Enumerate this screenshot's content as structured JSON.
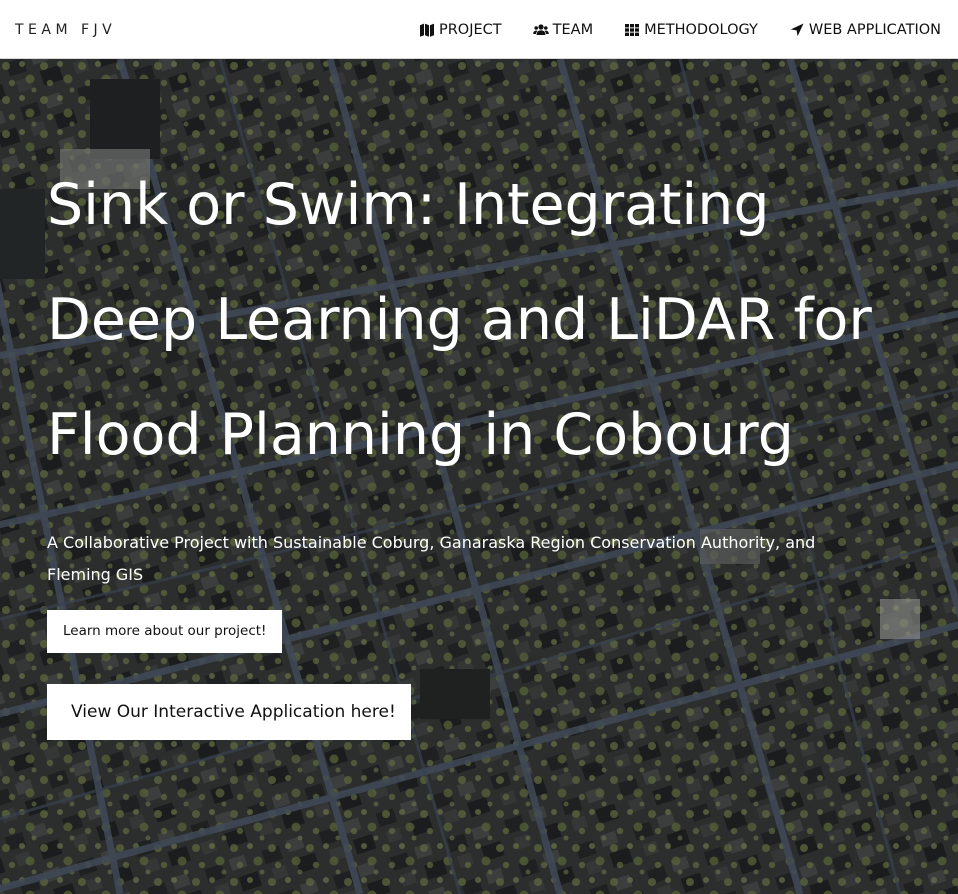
{
  "navbar": {
    "brand": "TEAM FJV",
    "links": [
      {
        "label": "PROJECT",
        "icon": "map-icon"
      },
      {
        "label": "TEAM",
        "icon": "users-icon"
      },
      {
        "label": "METHODOLOGY",
        "icon": "grid-icon"
      },
      {
        "label": "WEB APPLICATION",
        "icon": "location-arrow-icon"
      }
    ]
  },
  "hero": {
    "title": "Sink or Swim: Integrating Deep Learning and LiDAR for Flood Planning in Cobourg",
    "subtitle": "A Collaborative Project with Sustainable Coburg, Ganaraska Region Conservation Authority, and Fleming GIS",
    "learn_button": "Learn more about our project!",
    "app_button": "View Our Interactive Application here!",
    "background": "aerial-imagery"
  },
  "colors": {
    "nav_bg": "#ffffff",
    "nav_text": "#111111",
    "hero_text": "#ffffff",
    "button_bg": "#ffffff",
    "vegetation": "#8a9a5b",
    "road": "#5b6a80"
  }
}
